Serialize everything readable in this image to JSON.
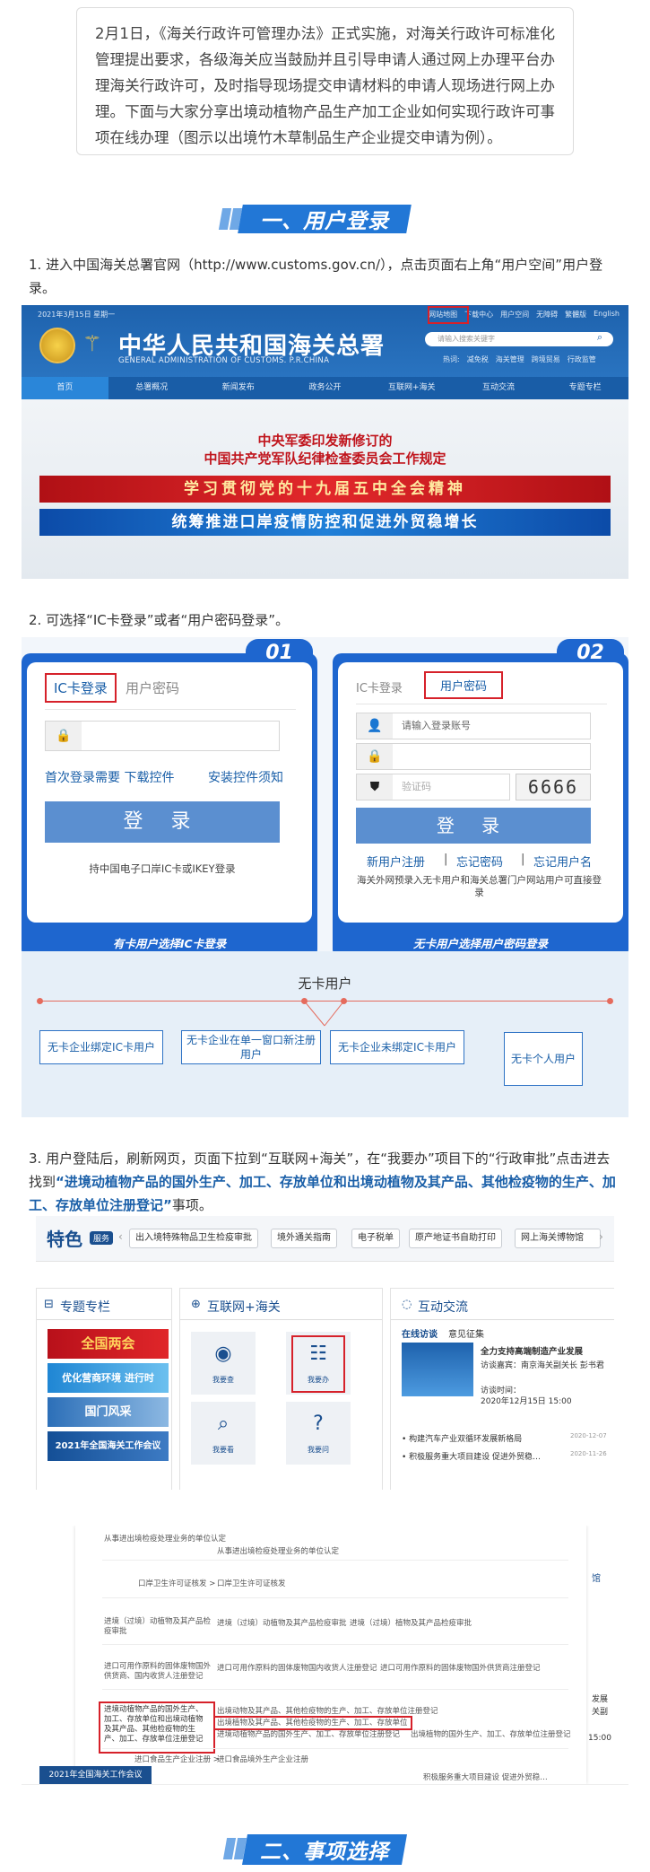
{
  "intro": {
    "text": "2月1日，《海关行政许可管理办法》正式实施，对海关行政许可标准化管理提出要求，各级海关应当鼓励并且引导申请人通过网上办理平台办理海关行政许可，及时指导现场提交申请材料的申请人现场进行网上办理。下面与大家分享出境动植物产品生产加工企业如何实现行政许可事项在线办理（图示以出境竹木草制品生产企业提交申请为例）。"
  },
  "section1": {
    "title": "一、用户登录"
  },
  "step1": {
    "text": "1. 进入中国海关总署官网（http://www.customs.gov.cn/），点击页面右上角“用户空间”用户登录。"
  },
  "site": {
    "date": "2021年3月15日 星期一",
    "toplinks": [
      "网站地图",
      "下载中心",
      "用户空间",
      "无障碍",
      "繁體版",
      "English"
    ],
    "title": "中华人民共和国海关总署",
    "subtitle": "GENERAL ADMINISTRATION OF CUSTOMS. P.R.CHINA",
    "search_placeholder": "请输入搜索关键字",
    "hot_label": "热词:",
    "hot": [
      "减免税",
      "海关管理",
      "跨境贸易",
      "行政监管"
    ],
    "nav": [
      "首页",
      "总署概况",
      "新闻发布",
      "政务公开",
      "互联网+海关",
      "互动交流",
      "专题专栏"
    ],
    "headline1": "中央军委印发新修订的",
    "headline2": "中国共产党军队纪律检查委员会工作规定",
    "banner_red": "学习贯彻党的十九届五中全会精神",
    "banner_blue": "统筹推进口岸疫情防控和促进外贸稳增长"
  },
  "step2": {
    "text": "2. 可选择“IC卡登录”或者“用户密码登录”。"
  },
  "login_ic": {
    "num": "01",
    "tab_active": "IC卡登录",
    "tab_other": "用户密码",
    "link1": "首次登录需要 下载控件",
    "link2": "安装控件须知",
    "button": "登 录",
    "note": "持中国电子口岸IC卡或IKEY登录",
    "caption": "有卡用户选择IC卡登录"
  },
  "login_pw": {
    "num": "02",
    "tab_other": "IC卡登录",
    "tab_active": "用户密码",
    "account_placeholder": "请输入登录账号",
    "captcha_placeholder": "验证码",
    "captcha": "6666",
    "button": "登 录",
    "link1": "新用户注册",
    "link2": "忘记密码",
    "link3": "忘记用户名",
    "note": "海关外网预录入无卡用户和海关总署门户网站用户可直接登录",
    "caption": "无卡用户选择用户密码登录"
  },
  "nocard": {
    "title": "无卡用户",
    "options": [
      "无卡企业绑定IC卡用户",
      "无卡企业在单一窗口新注册用户",
      "无卡企业未绑定IC卡用户",
      "无卡个人用户"
    ]
  },
  "step3": {
    "text": "3. 用户登陆后，刷新网页，页面下拉到“互联网+海关”，在“我要办”项目下的“行政审批”点击进去找到",
    "highlight": "“进境动植物产品的国外生产、加工、存放单位和出境动植物及其产品、其他检疫物的生产、加工、存放单位注册登记”",
    "tail": "事项。"
  },
  "special": {
    "label": "特色",
    "badge": "服务",
    "items": [
      "出入境特殊物品卫生检疫审批",
      "境外通关指南",
      "电子税单",
      "原产地证书自助打印",
      "网上海关博物馆"
    ]
  },
  "panels": {
    "topic": "专题专栏",
    "topic_tiles": [
      "全国两会",
      "优化营商环境 进行时",
      "国门风采",
      "2021年全国海关工作会议"
    ],
    "internet": "互联网+海关",
    "services": [
      "我要查",
      "我要办",
      "我要看",
      "我要问"
    ],
    "interact": "互动交流",
    "interact_tabs": [
      "在线访谈",
      "意见征集"
    ],
    "news_title": "全力支持高端制造产业发展",
    "news_guest": "访谈嘉宾：南京海关副关长 彭书君",
    "news_time_label": "访谈时间：",
    "news_time": "2020年12月15日 15:00",
    "news_items": [
      {
        "text": "构建汽车产业双循环发展新格局",
        "date": "2020-12-07"
      },
      {
        "text": "积极服务重大项目建设 促进外贸稳…",
        "date": "2020-11-26"
      }
    ]
  },
  "approval": {
    "rows": [
      "从事进出境检疫处理业务的单位认定",
      "口岸卫生许可证核发",
      "进境（过境）动植物及其产品检疫审批",
      "进口可用作原料的固体废物国外供货商、国内收货人注册登记",
      "进境动植物产品的国外生产、加工、存放单位和出境动植物及其产品、其他检疫物的生产、加工、存放单位注册登记",
      "进口食品生产企业注册"
    ],
    "subitems": [
      "从事进出境检疫处理业务的单位认定",
      "口岸卫生许可证核发",
      "进境（过境）动植物及其产品检疫审批",
      "进境（过境）植物及其产品检疫审批",
      "进口可用作原料的固体废物国内收货人注册登记",
      "进口可用作原料的固体废物国外供货商注册登记",
      "出境动物及其产品、其他检疫物的生产、加工、存放单位注册登记",
      "出境植物及其产品、其他检疫物的生产、加工、存放单位注册登记",
      "进境动植物产品的国外生产、加工、存放单位注册登记",
      "出境植物的国外生产、加工、存放单位注册登记",
      "进口食品境外生产企业注册"
    ],
    "side_right": [
      "馆",
      "发展",
      "关副",
      "15:00"
    ],
    "footer_left": "2021年全国海关工作会议",
    "footer_news": "积极服务重大项目建设 促进外贸稳…"
  },
  "section2": {
    "title": "二、事项选择"
  }
}
